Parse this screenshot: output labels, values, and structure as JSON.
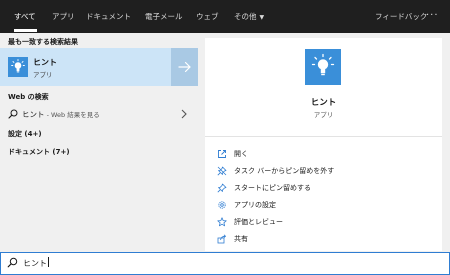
{
  "tabs": [
    {
      "label": "すべて",
      "active": true
    },
    {
      "label": "アプリ",
      "active": false
    },
    {
      "label": "ドキュメント",
      "active": false
    },
    {
      "label": "電子メール",
      "active": false
    },
    {
      "label": "ウェブ",
      "active": false
    },
    {
      "label": "その他",
      "active": false,
      "has_dropdown": true
    }
  ],
  "feedback_label": "フィードバック",
  "more_label": "···",
  "best_match": {
    "heading": "最も一致する検索結果",
    "title": "ヒント",
    "subtitle": "アプリ",
    "icon": "lightbulb-icon",
    "arrow_icon": "arrow-right-icon"
  },
  "web_search": {
    "heading": "Web の検索",
    "query": "ヒント",
    "suffix": " - Web 結果を見る"
  },
  "settings_group": {
    "label": "設定 (4+)"
  },
  "documents_group": {
    "label": "ドキュメント (7+)"
  },
  "preview": {
    "title": "ヒント",
    "subtitle": "アプリ",
    "icon": "lightbulb-icon",
    "actions": [
      {
        "label": "開く",
        "icon": "open-icon"
      },
      {
        "label": "タスク バーからピン留めを外す",
        "icon": "unpin-icon"
      },
      {
        "label": "スタートにピン留めする",
        "icon": "pin-icon"
      },
      {
        "label": "アプリの設定",
        "icon": "gear-icon"
      },
      {
        "label": "評価とレビュー",
        "icon": "star-icon"
      },
      {
        "label": "共有",
        "icon": "share-icon"
      }
    ]
  },
  "search": {
    "value": "ヒント"
  },
  "colors": {
    "accent": "#3a8fd9",
    "selected_bg": "#cce4f7",
    "topbar_bg": "#1f1f1f",
    "search_border": "#2f7dd2"
  }
}
